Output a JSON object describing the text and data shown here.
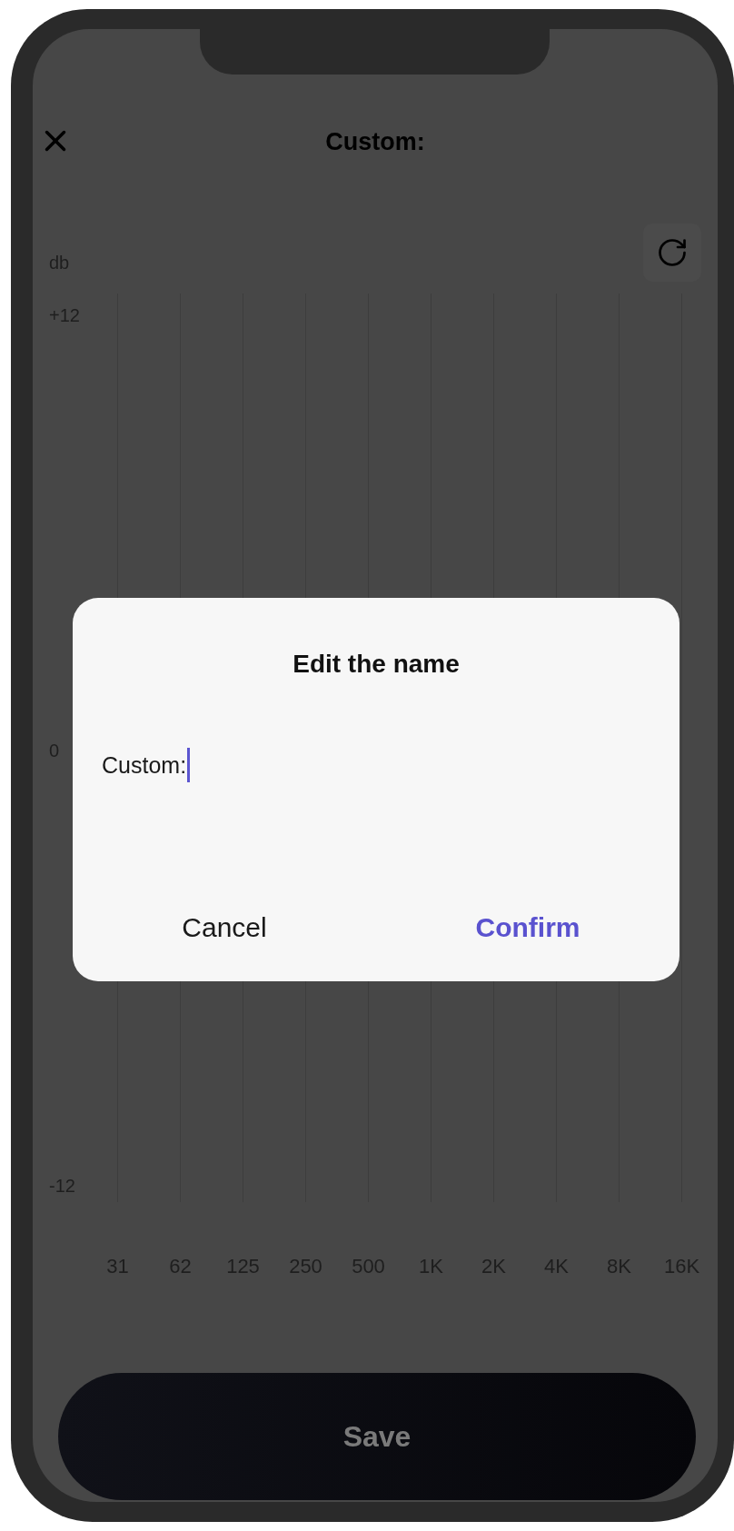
{
  "header": {
    "title": "Custom:"
  },
  "equalizer": {
    "unit": "db",
    "y_labels": [
      "+12",
      "0",
      "-12"
    ],
    "bands": [
      "31",
      "62",
      "125",
      "250",
      "500",
      "1K",
      "2K",
      "4K",
      "8K",
      "16K"
    ]
  },
  "save_button": "Save",
  "dialog": {
    "title": "Edit the name",
    "field_value": "Custom:",
    "buttons": [
      {
        "label": "Cancel",
        "kind": "cancel"
      },
      {
        "label": "Confirm",
        "kind": "confirm"
      }
    ]
  }
}
